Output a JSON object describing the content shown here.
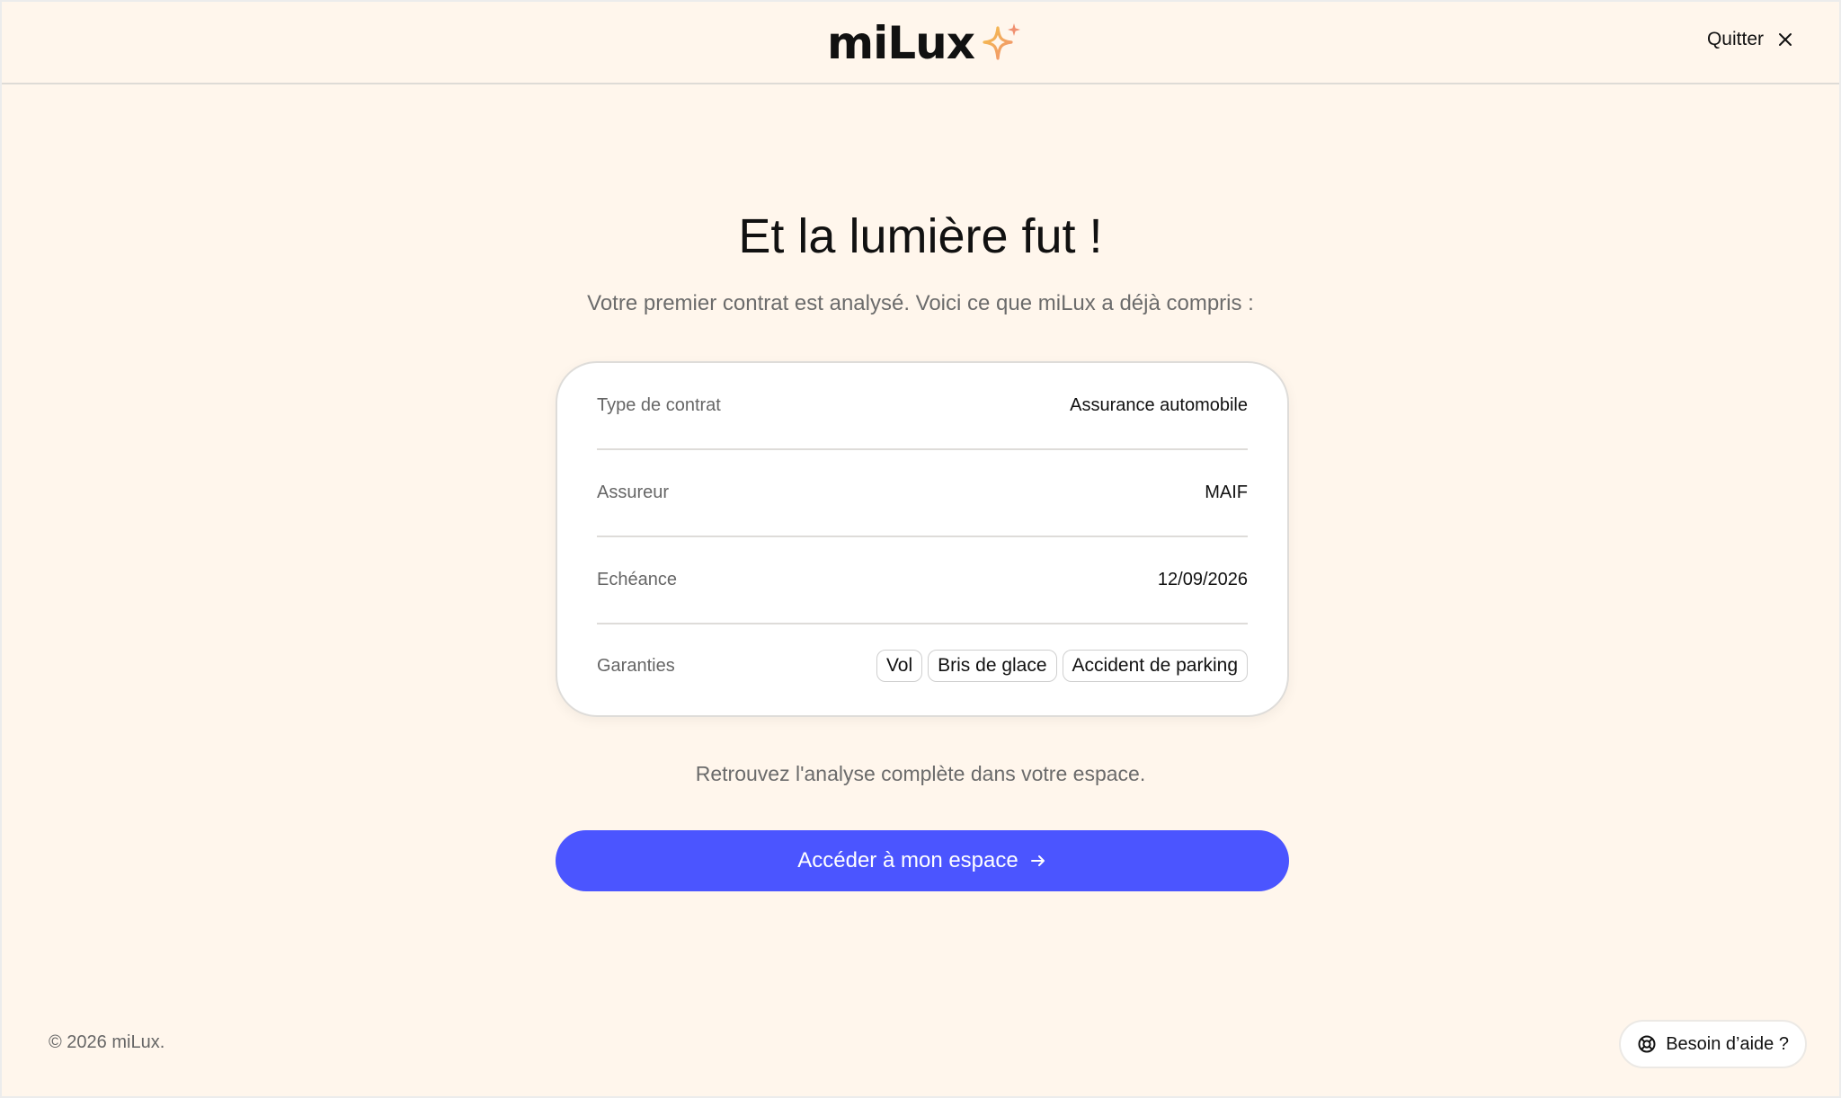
{
  "header": {
    "logo_text": "miLux",
    "quit_label": "Quitter"
  },
  "main": {
    "title": "Et la lumière fut !",
    "subtitle": "Votre premier contrat est analysé. Voici ce que miLux a déjà compris :",
    "summary": {
      "rows": [
        {
          "label": "Type de contrat",
          "value": "Assurance automobile"
        },
        {
          "label": "Assureur",
          "value": "MAIF"
        },
        {
          "label": "Echéance",
          "value": "12/09/2026"
        }
      ],
      "guarantees_label": "Garanties",
      "guarantees": [
        "Vol",
        "Bris de glace",
        "Accident de parking"
      ]
    },
    "note": "Retrouvez l'analyse complète dans votre espace.",
    "cta_label": "Accéder à mon espace"
  },
  "footer": {
    "copyright": "© 2026 miLux.",
    "help_label": "Besoin d’aide ?"
  },
  "colors": {
    "background": "#fff6ec",
    "accent": "#4b55ff",
    "star_gradient": [
      "#f5c04a",
      "#f09070"
    ]
  },
  "icons": {
    "logo": "sparkle-icon",
    "quit": "close-icon",
    "cta": "arrow-right-icon",
    "help": "lifebuoy-icon"
  }
}
